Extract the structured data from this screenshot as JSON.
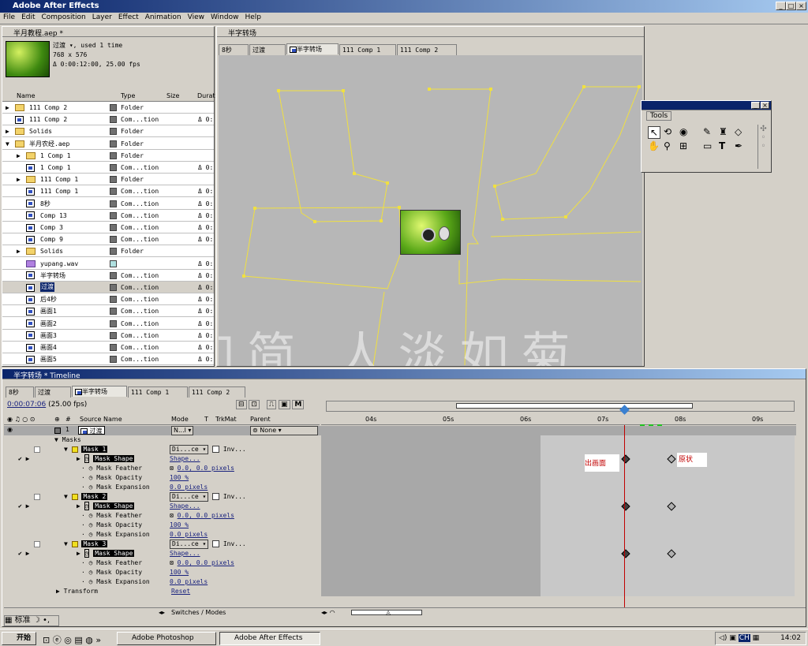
{
  "app": {
    "title": "Adobe After Effects"
  },
  "menu": [
    "File",
    "Edit",
    "Composition",
    "Layer",
    "Effect",
    "Animation",
    "View",
    "Window",
    "Help"
  ],
  "project": {
    "title": "半月教程.aep *",
    "selected_name": "过渡",
    "used": "used 1 time",
    "dims": "768 x 576",
    "dur": "Δ 0:00:12:00, 25.00 fps",
    "cols": [
      "Name",
      "Type",
      "Size",
      "Durat"
    ],
    "items": [
      {
        "name": "111 Comp 2",
        "type": "Folder",
        "dur": ""
      },
      {
        "name": "111 Comp 2",
        "type": "Com...tion",
        "dur": "Δ 0:"
      },
      {
        "name": "Solids",
        "type": "Folder",
        "dur": ""
      },
      {
        "name": "半月农经.aep",
        "type": "Folder",
        "dur": ""
      },
      {
        "name": "1 Comp 1",
        "type": "Folder",
        "dur": ""
      },
      {
        "name": "1 Comp 1",
        "type": "Com...tion",
        "dur": "Δ 0:"
      },
      {
        "name": "111 Comp 1",
        "type": "Folder",
        "dur": ""
      },
      {
        "name": "111 Comp 1",
        "type": "Com...tion",
        "dur": "Δ 0:"
      },
      {
        "name": "8秒",
        "type": "Com...tion",
        "dur": "Δ 0:"
      },
      {
        "name": "Comp 13",
        "type": "Com...tion",
        "dur": "Δ 0:"
      },
      {
        "name": "Comp 3",
        "type": "Com...tion",
        "dur": "Δ 0:"
      },
      {
        "name": "Comp 9",
        "type": "Com...tion",
        "dur": "Δ 0:"
      },
      {
        "name": "Solids",
        "type": "Folder",
        "dur": ""
      },
      {
        "name": "yupang.wav",
        "type": "",
        "dur": "Δ 0:"
      },
      {
        "name": "半字转场",
        "type": "Com...tion",
        "dur": "Δ 0:"
      },
      {
        "name": "过渡",
        "type": "Com...tion",
        "dur": "Δ 0:"
      },
      {
        "name": "后4秒",
        "type": "Com...tion",
        "dur": "Δ 0:"
      },
      {
        "name": "画面1",
        "type": "Com...tion",
        "dur": "Δ 0:"
      },
      {
        "name": "画面2",
        "type": "Com...tion",
        "dur": "Δ 0:"
      },
      {
        "name": "画面3",
        "type": "Com...tion",
        "dur": "Δ 0:"
      },
      {
        "name": "画面4",
        "type": "Com...tion",
        "dur": "Δ 0:"
      },
      {
        "name": "画面5",
        "type": "Com...tion",
        "dur": "Δ 0:"
      }
    ]
  },
  "comp": {
    "title": "半字转场",
    "tabs": [
      "8秒",
      "过渡",
      "半字转场",
      "111 Comp 1",
      "111 Comp 2"
    ],
    "watermark": "素如简 人淡如菊"
  },
  "tools": {
    "title": "Tools"
  },
  "timeline": {
    "title": "半字转场 * Timeline",
    "tabs": [
      "8秒",
      "过渡",
      "半字转场",
      "111 Comp 1",
      "111 Comp 2"
    ],
    "timecode": "0:00:07:06",
    "fps": "(25.00 fps)",
    "headers": {
      "source": "Source Name",
      "mode": "Mode",
      "t": "T",
      "trkmat": "TrkMat",
      "parent": "Parent"
    },
    "ruler": [
      "04s",
      "05s",
      "06s",
      "07s",
      "08s",
      "09s"
    ],
    "layer": {
      "num": "1",
      "name": "过渡",
      "mode": "N...l",
      "parent": "None"
    },
    "masks_label": "Masks",
    "masks": [
      {
        "name": "Mask 1",
        "mode": "Di...ce",
        "inv": "Inv...",
        "shape": "Shape...",
        "feather": "0.0, 0.0 pixels",
        "opacity": "100 %",
        "expansion": "0.0 pixels"
      },
      {
        "name": "Mask 2",
        "mode": "Di...ce",
        "inv": "Inv...",
        "shape": "Shape...",
        "feather": "0.0, 0.0 pixels",
        "opacity": "100 %",
        "expansion": "0.0 pixels"
      },
      {
        "name": "Mask 3",
        "mode": "Di...ce",
        "inv": "Inv...",
        "shape": "Shape...",
        "feather": "0.0, 0.0 pixels",
        "opacity": "100 %",
        "expansion": "0.0 pixels"
      }
    ],
    "prop_labels": {
      "shape": "Mask Shape",
      "feather": "Mask Feather",
      "opacity": "Mask Opacity",
      "expansion": "Mask Expansion"
    },
    "transform": "Transform",
    "reset": "Reset",
    "annot_out": "出画面",
    "annot_orig": "原状",
    "switches": "Switches / Modes"
  },
  "taskbar": {
    "start": "开始",
    "ime": "标准",
    "items": [
      "Adobe Photoshop",
      "Adobe After Effects"
    ],
    "clock": "14:02",
    "tray_ch": "CH"
  }
}
